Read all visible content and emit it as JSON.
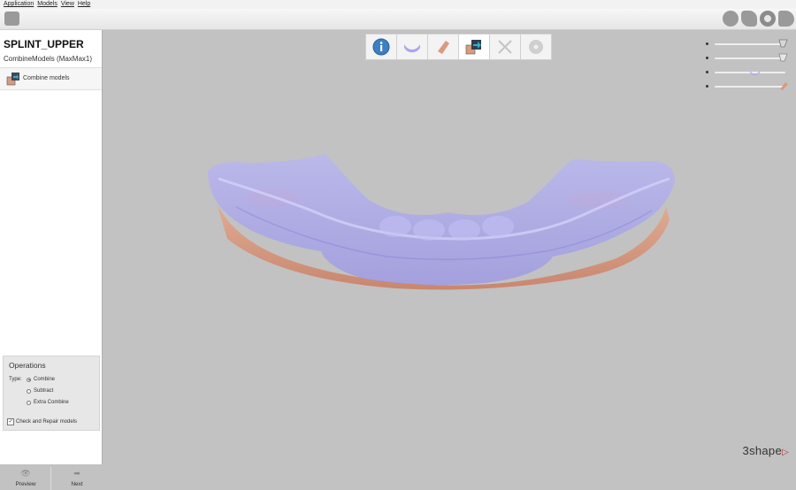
{
  "menu": [
    "Application",
    "Models",
    "View",
    "Help"
  ],
  "project": {
    "title": "SPLINT_UPPER",
    "subtitle": "CombineModels (MaxMax1)"
  },
  "steps": [
    {
      "label": "Combine models",
      "icon": "combine-models-icon"
    }
  ],
  "operations": {
    "title": "Operations",
    "type_label": "Type:",
    "options": [
      "Combine",
      "Subtract",
      "Extra Combine"
    ],
    "selected": "Combine",
    "check_label": "Check and Repair models",
    "check_checked": true
  },
  "nav": {
    "preview": "Preview",
    "next": "Next"
  },
  "wizard": [
    {
      "icon": "info-icon",
      "state": "done"
    },
    {
      "icon": "splint-icon",
      "state": "done"
    },
    {
      "icon": "model-icon",
      "state": "done"
    },
    {
      "icon": "combine-icon",
      "state": "active"
    },
    {
      "icon": "tools-icon",
      "state": "disabled"
    },
    {
      "icon": "disc-icon",
      "state": "disabled"
    }
  ],
  "toolbar_right_icons": [
    "sphere-icon",
    "cube-icon",
    "ring-icon",
    "tooth-icon"
  ],
  "sliders": [
    {
      "name": "opacity-1",
      "value": 1.0,
      "thumb": "gray"
    },
    {
      "name": "opacity-2",
      "value": 1.0,
      "thumb": "gray"
    },
    {
      "name": "opacity-3",
      "value": 0.6,
      "thumb": "splint"
    },
    {
      "name": "opacity-4",
      "value": 1.0,
      "thumb": "model"
    }
  ],
  "colors": {
    "splint": "#a9a6ea",
    "model": "#d99a7f",
    "background": "#c2c2c2"
  },
  "brand": "3shape"
}
